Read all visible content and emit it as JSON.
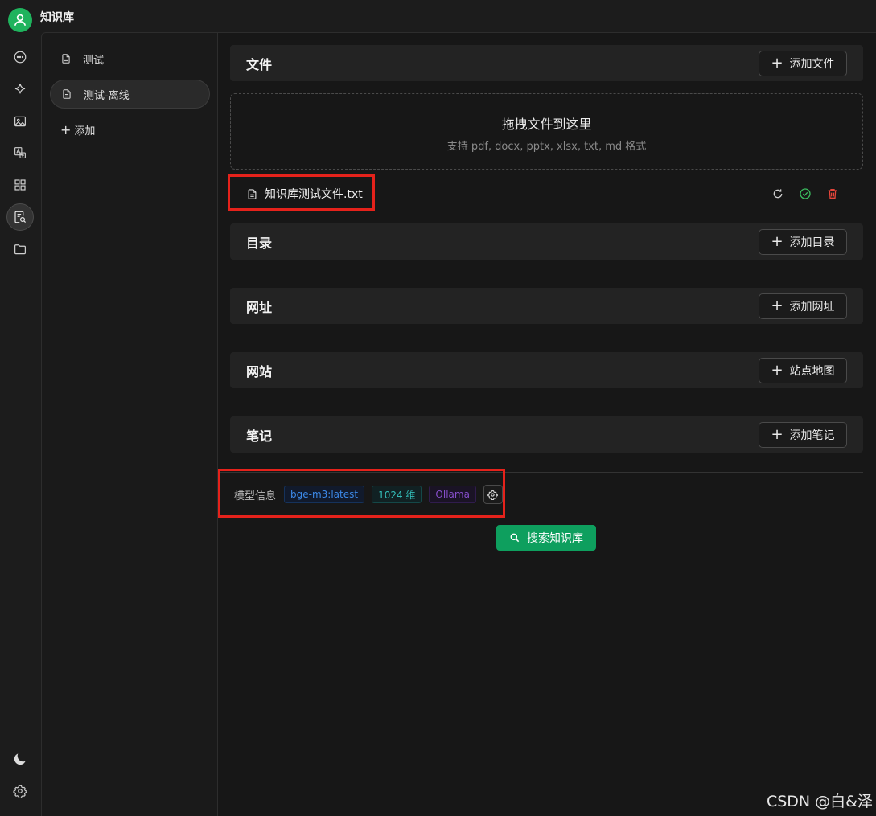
{
  "app": {
    "title": "知识库"
  },
  "rail": {
    "icons": [
      "chat-icon",
      "sparkle-icon",
      "image-icon",
      "translate-icon",
      "apps-icon",
      "knowledge-icon",
      "folder-icon"
    ],
    "bottom_icons": [
      "moon-icon",
      "settings-icon"
    ],
    "active": "knowledge-icon"
  },
  "sidebar": {
    "items": [
      {
        "label": "测试"
      },
      {
        "label": "测试-离线"
      }
    ],
    "active_index": 1,
    "add_label": "添加"
  },
  "sections": {
    "file": {
      "title": "文件",
      "button": "添加文件"
    },
    "directory": {
      "title": "目录",
      "button": "添加目录"
    },
    "url": {
      "title": "网址",
      "button": "添加网址"
    },
    "website": {
      "title": "网站",
      "button": "站点地图"
    },
    "notes": {
      "title": "笔记",
      "button": "添加笔记"
    }
  },
  "dropzone": {
    "title": "拖拽文件到这里",
    "subtitle": "支持 pdf, docx, pptx, xlsx, txt, md 格式"
  },
  "files": [
    {
      "name": "知识库测试文件.txt",
      "status": "success"
    }
  ],
  "model_info": {
    "label": "模型信息",
    "model": "bge-m3:latest",
    "dimensions": "1024 维",
    "provider": "Ollama"
  },
  "search_button": "搜索知识库",
  "watermark": "CSDN @白&泽",
  "colors": {
    "accent": "#1fb35d",
    "search_button": "#0e9f5e",
    "highlight_box": "#e5221b",
    "success": "#3bbd5f",
    "danger": "#e5453a"
  }
}
